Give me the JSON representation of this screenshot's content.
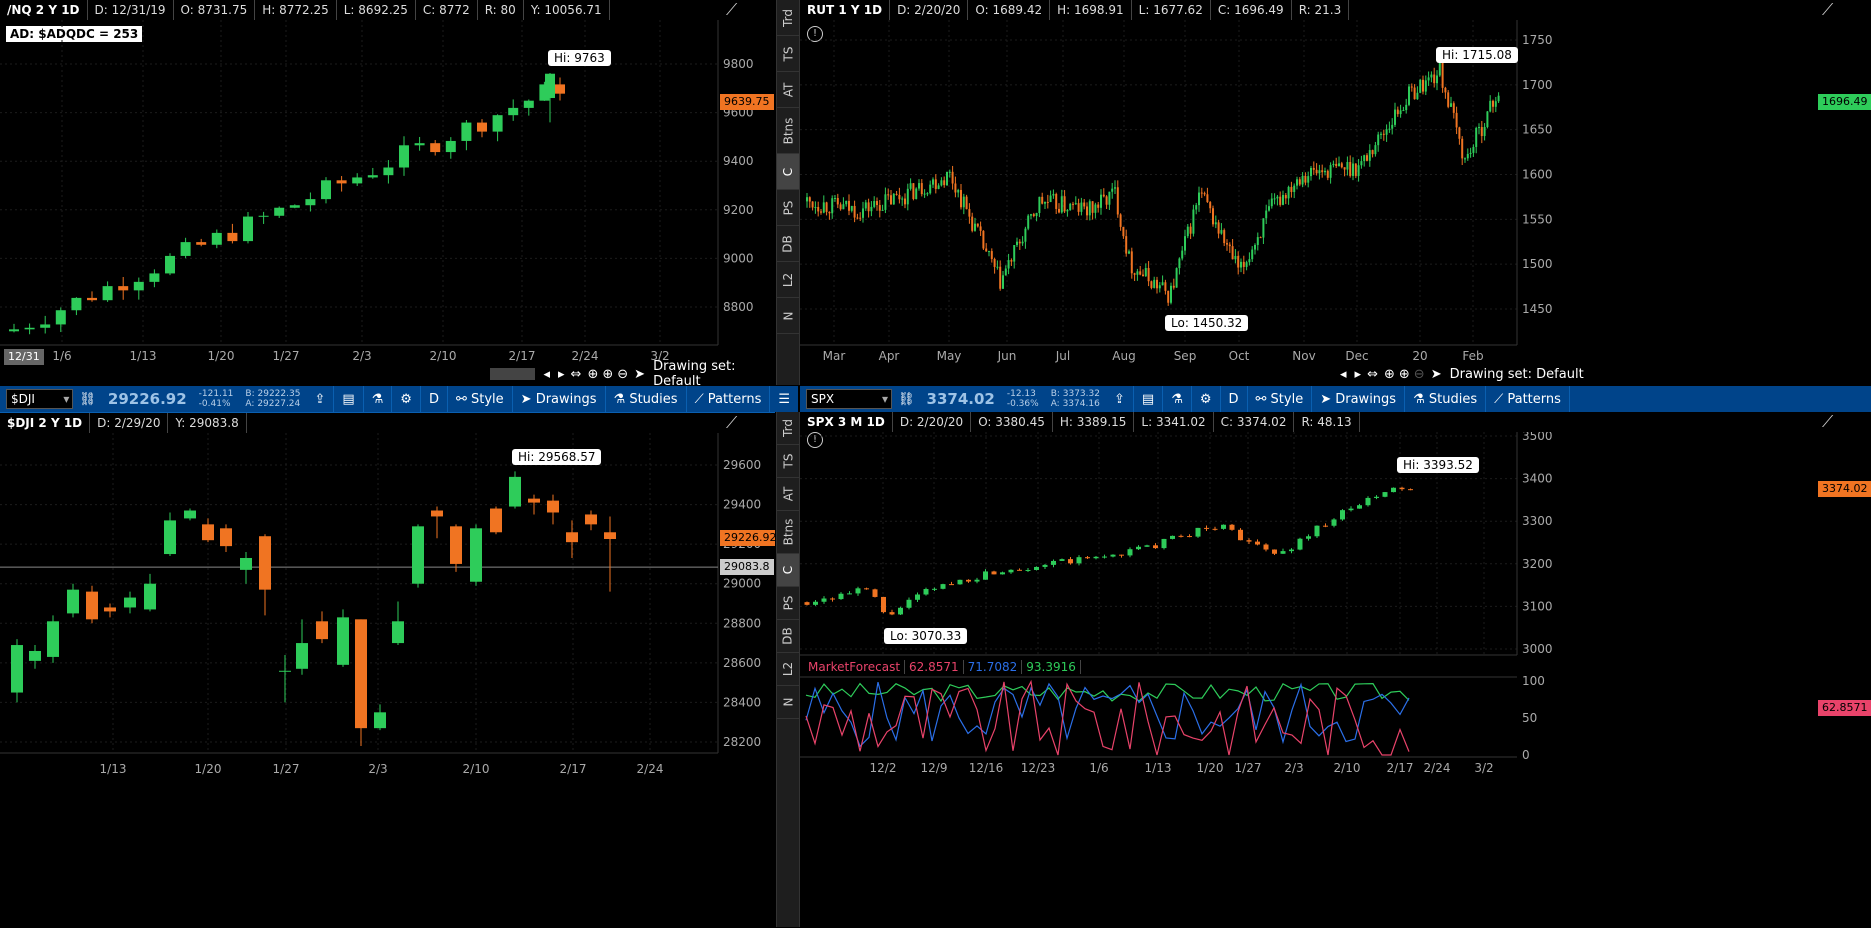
{
  "pane_tl": {
    "header": {
      "symbol": "/NQ 2 Y 1D",
      "date": "D: 12/31/19",
      "open": "O: 8731.75",
      "high": "H: 8772.25",
      "low": "L: 8692.25",
      "close": "C: 8772",
      "range": "R: 80",
      "y": "Y: 10056.71"
    },
    "ad_label": "AD: $ADQDC = 253",
    "hi_callout": "Hi: 9763",
    "last_tag": "9639.75",
    "date_tag": "12/31",
    "y_ticks": [
      "9800",
      "9600",
      "9400",
      "9200",
      "9000",
      "8800"
    ],
    "x_ticks": [
      "1/6",
      "1/13",
      "1/20",
      "1/27",
      "2/3",
      "2/10",
      "2/17",
      "2/24",
      "3/2"
    ],
    "drawing_set": "Drawing set: Default"
  },
  "pane_tr": {
    "header": {
      "symbol": "RUT 1 Y 1D",
      "date": "D: 2/20/20",
      "open": "O: 1689.42",
      "high": "H: 1698.91",
      "low": "L: 1677.62",
      "close": "C: 1696.49",
      "range": "R: 21.3"
    },
    "hi_callout": "Hi: 1715.08",
    "lo_callout": "Lo: 1450.32",
    "last_tag": "1696.49",
    "y_ticks": [
      "1750",
      "1700",
      "1650",
      "1600",
      "1550",
      "1500",
      "1450"
    ],
    "x_ticks": [
      "Mar",
      "Apr",
      "May",
      "Jun",
      "Jul",
      "Aug",
      "Sep",
      "Oct",
      "Nov",
      "Dec",
      "20",
      "Feb"
    ],
    "drawing_set": "Drawing set: Default"
  },
  "pane_bl": {
    "toolbar": {
      "symbol": "$DJI",
      "price": "29226.92",
      "chg": "-121.11",
      "chg_pct": "-0.41%",
      "bid": "B: 29222.35",
      "ask": "A: 29227.24",
      "agg": "D",
      "style": "Style",
      "drawings": "Drawings",
      "studies": "Studies",
      "patterns": "Patterns"
    },
    "header": {
      "symbol": "$DJI 2 Y 1D",
      "date": "D: 2/29/20",
      "y": "Y: 29083.8"
    },
    "hi_callout": "Hi: 29568.57",
    "last_tag": "29226.92",
    "cursor_tag": "29083.8",
    "y_ticks": [
      "29600",
      "29400",
      "29200",
      "29000",
      "28800",
      "28600",
      "28400",
      "28200"
    ],
    "x_ticks": [
      "1/13",
      "1/20",
      "1/27",
      "2/3",
      "2/10",
      "2/17",
      "2/24"
    ]
  },
  "pane_br": {
    "toolbar": {
      "symbol": "SPX",
      "price": "3374.02",
      "chg": "-12.13",
      "chg_pct": "-0.36%",
      "bid": "B: 3373.32",
      "ask": "A: 3374.16",
      "agg": "D",
      "style": "Style",
      "drawings": "Drawings",
      "studies": "Studies",
      "patterns": "Patterns"
    },
    "header": {
      "symbol": "SPX 3 M 1D",
      "date": "D: 2/20/20",
      "open": "O: 3380.45",
      "high": "H: 3389.15",
      "low": "L: 3341.02",
      "close": "C: 3374.02",
      "range": "R: 48.13"
    },
    "hi_callout": "Hi: 3393.52",
    "lo_callout": "Lo: 3070.33",
    "last_tag": "3374.02",
    "y_ticks": [
      "3500",
      "3400",
      "3300",
      "3200",
      "3100",
      "3000"
    ],
    "study": {
      "name": "MarketForecast",
      "v1": "62.8571",
      "v2": "71.7082",
      "v3": "93.3916",
      "tag": "62.8571",
      "ticks": [
        "100",
        "50",
        "0"
      ]
    },
    "x_ticks": [
      "12/2",
      "12/9",
      "12/16",
      "12/23",
      "1/6",
      "1/13",
      "1/20",
      "1/27",
      "2/3",
      "2/10",
      "2/17",
      "2/24",
      "3/2"
    ]
  },
  "sidebar": [
    "Trd",
    "TS",
    "AT",
    "Btns",
    "C",
    "PS",
    "DB",
    "L2",
    "N"
  ],
  "colors": {
    "up": "#2ecc5a",
    "down": "#f07422",
    "bg": "#000000",
    "toolbar": "#00448a",
    "red_line": "#e8436a",
    "blue_line": "#2b6fe8",
    "green_line": "#2ecc5a"
  }
}
